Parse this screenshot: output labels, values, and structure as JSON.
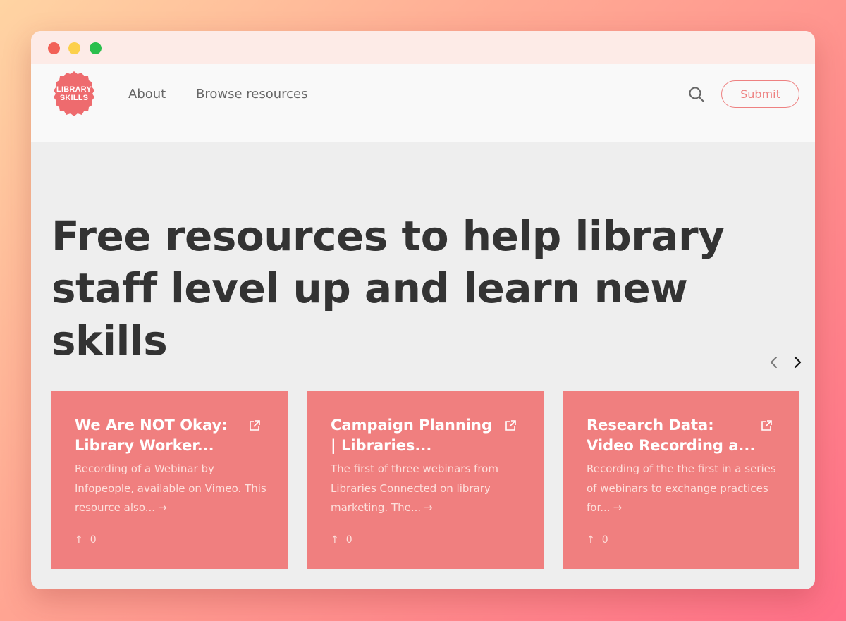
{
  "window": {
    "controls": [
      "close",
      "minimize",
      "maximize"
    ]
  },
  "nav": {
    "logo_line1": "LIBRARY",
    "logo_line2": "SKILLS",
    "links": [
      {
        "label": "About"
      },
      {
        "label": "Browse resources"
      }
    ],
    "search_icon": "search-icon",
    "submit_label": "Submit"
  },
  "hero": {
    "title": "Free resources to help library staff level up and learn new skills"
  },
  "carousel": {
    "prev_icon": "chevron-left-icon",
    "next_icon": "chevron-right-icon"
  },
  "cards": [
    {
      "title": "We Are NOT Okay: Library Worker...",
      "description": "Recording of a Webinar by Infopeople, available on Vimeo. This resource also...",
      "more": "→",
      "vote_icon": "↑",
      "votes": "0"
    },
    {
      "title": "Campaign Planning | Libraries...",
      "description": "The first of three webinars from Libraries Connected on library marketing. The...",
      "more": "→",
      "vote_icon": "↑",
      "votes": "0"
    },
    {
      "title": "Research Data: Video Recording a...",
      "description": "Recording of the the first in a series of webinars to exchange practices for...",
      "more": "→",
      "vote_icon": "↑",
      "votes": "0"
    }
  ],
  "colors": {
    "accent": "#ee8181",
    "card": "#f07f7f",
    "heading": "#333333"
  }
}
